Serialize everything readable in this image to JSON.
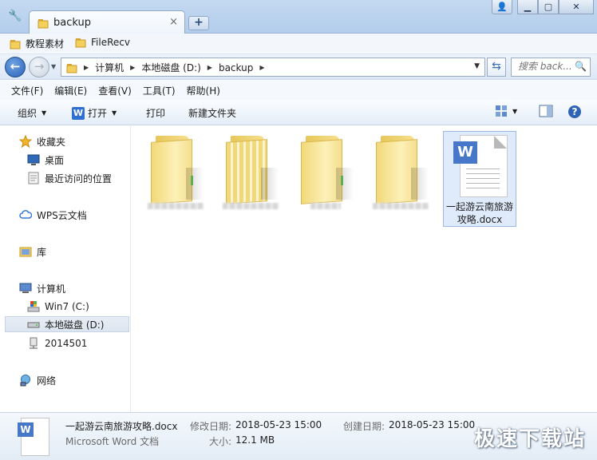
{
  "tab": {
    "title": "backup"
  },
  "favorites": [
    {
      "label": "教程素材"
    },
    {
      "label": "FileRecv"
    }
  ],
  "address": {
    "crumbs": [
      "计算机",
      "本地磁盘 (D:)",
      "backup"
    ]
  },
  "search": {
    "placeholder": "搜索 back..."
  },
  "menu": {
    "file": "文件(F)",
    "edit": "编辑(E)",
    "view": "查看(V)",
    "tools": "工具(T)",
    "help": "帮助(H)"
  },
  "commands": {
    "organize": "组织",
    "open": "打开",
    "print": "打印",
    "new_folder": "新建文件夹"
  },
  "nav": {
    "favorites": "收藏夹",
    "desktop": "桌面",
    "recent": "最近访问的位置",
    "wps": "WPS云文档",
    "library": "库",
    "computer": "计算机",
    "drive_c": "Win7 (C:)",
    "drive_d": "本地磁盘 (D:)",
    "net_drive": "2014501",
    "network": "网络"
  },
  "files": [
    {
      "type": "folder",
      "label": ""
    },
    {
      "type": "folder",
      "label": ""
    },
    {
      "type": "folder",
      "label": ""
    },
    {
      "type": "folder",
      "label": ""
    },
    {
      "type": "docx",
      "label": "一起游云南旅游攻略.docx",
      "badge": "W"
    }
  ],
  "details": {
    "filename": "一起游云南旅游攻略.docx",
    "filetype": "Microsoft Word 文档",
    "modified_label": "修改日期:",
    "modified_value": "2018-05-23 15:00",
    "size_label": "大小:",
    "size_value": "12.1 MB",
    "created_label": "创建日期:",
    "created_value": "2018-05-23 15:00"
  },
  "watermark": "极速下载站",
  "colors": {
    "accent": "#2a62b8",
    "word_blue": "#4777c9",
    "folder_yellow": "#f1d878"
  }
}
